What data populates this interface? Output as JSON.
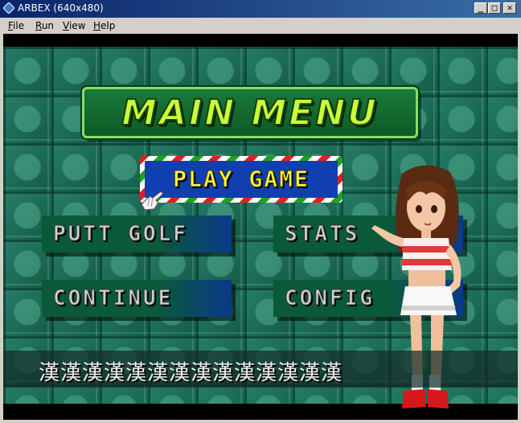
{
  "window": {
    "title": "ARBEX (640x480)",
    "controls": {
      "minimize": "_",
      "maximize": "□",
      "close": "✕"
    }
  },
  "menubar": {
    "items": [
      {
        "label": "File",
        "mnemonic": "F",
        "rest": "ile"
      },
      {
        "label": "Run",
        "mnemonic": "R",
        "rest": "un"
      },
      {
        "label": "View",
        "mnemonic": "V",
        "rest": "iew"
      },
      {
        "label": "Help",
        "mnemonic": "H",
        "rest": "elp"
      }
    ]
  },
  "game": {
    "banner_title": "MAIN MENU",
    "play_label": "PLAY GAME",
    "buttons": {
      "putt_golf": "PUTT GOLF",
      "stats": "STATS",
      "continue": "CONTINUE",
      "config": "CONFIG"
    },
    "message_text": "漢漢漢漢漢漢漢漢漢漢漢漢漢漢"
  },
  "colors": {
    "title_bar": "#0a246a",
    "playfield": "#14604f",
    "banner_text": "#c8ff3a",
    "play_text": "#ffff40"
  }
}
